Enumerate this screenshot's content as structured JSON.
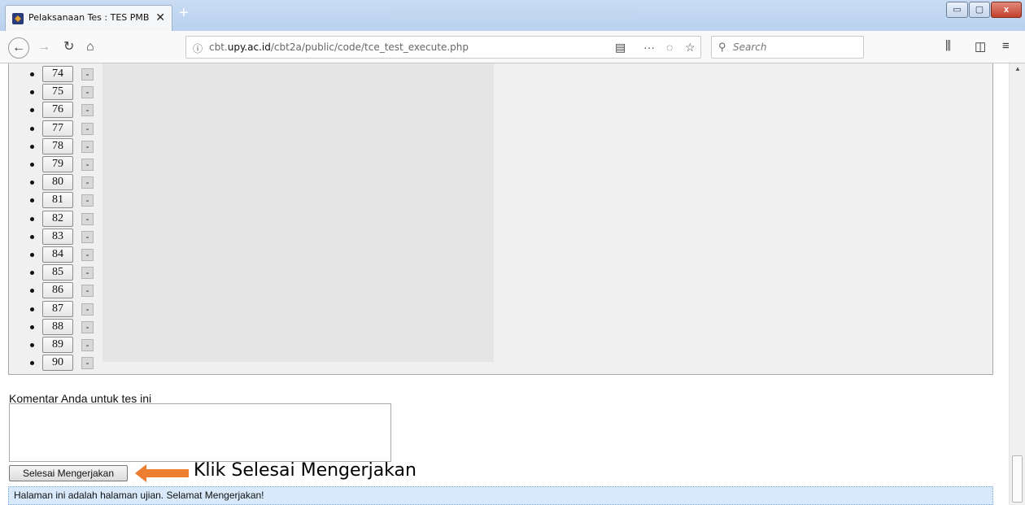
{
  "browser": {
    "tab_title": "Pelaksanaan Tes : TES PMB UPY",
    "tab_close": "✕",
    "new_tab": "+",
    "window_controls": {
      "minimize": "▭",
      "maximize": "▢",
      "close": "x"
    }
  },
  "navbar": {
    "url_host": "cbt.upy.ac.id",
    "url_prefix": "cbt.",
    "url_domain": "upy.ac.id",
    "url_path": "/cbt2a/public/code/tce_test_execute.php",
    "search_placeholder": "Search",
    "icons": [
      "back-icon",
      "forward-icon",
      "reload-icon",
      "home-icon",
      "info-icon",
      "reader-view-icon",
      "page-actions-icon",
      "pocket-icon",
      "bookmark-star-icon",
      "search-icon",
      "library-icon",
      "sidebar-icon",
      "menu-icon"
    ]
  },
  "questions": [
    {
      "number": "74",
      "status": "-"
    },
    {
      "number": "75",
      "status": "-"
    },
    {
      "number": "76",
      "status": "-"
    },
    {
      "number": "77",
      "status": "-"
    },
    {
      "number": "78",
      "status": "-"
    },
    {
      "number": "79",
      "status": "-"
    },
    {
      "number": "80",
      "status": "-"
    },
    {
      "number": "81",
      "status": "-"
    },
    {
      "number": "82",
      "status": "-"
    },
    {
      "number": "83",
      "status": "-"
    },
    {
      "number": "84",
      "status": "-"
    },
    {
      "number": "85",
      "status": "-"
    },
    {
      "number": "86",
      "status": "-"
    },
    {
      "number": "87",
      "status": "-"
    },
    {
      "number": "88",
      "status": "-"
    },
    {
      "number": "89",
      "status": "-"
    },
    {
      "number": "90",
      "status": "-"
    }
  ],
  "comment": {
    "label": "Komentar Anda untuk tes ini",
    "value": ""
  },
  "submit_label": "Selesai Mengerjakan",
  "callout_text": "Klik Selesai Mengerjakan",
  "footer_message": "Halaman ini adalah halaman ujian. Selamat Mengerjakan!",
  "colors": {
    "arrow": "#ed7d31",
    "footer_bg": "#d7e9fb"
  }
}
